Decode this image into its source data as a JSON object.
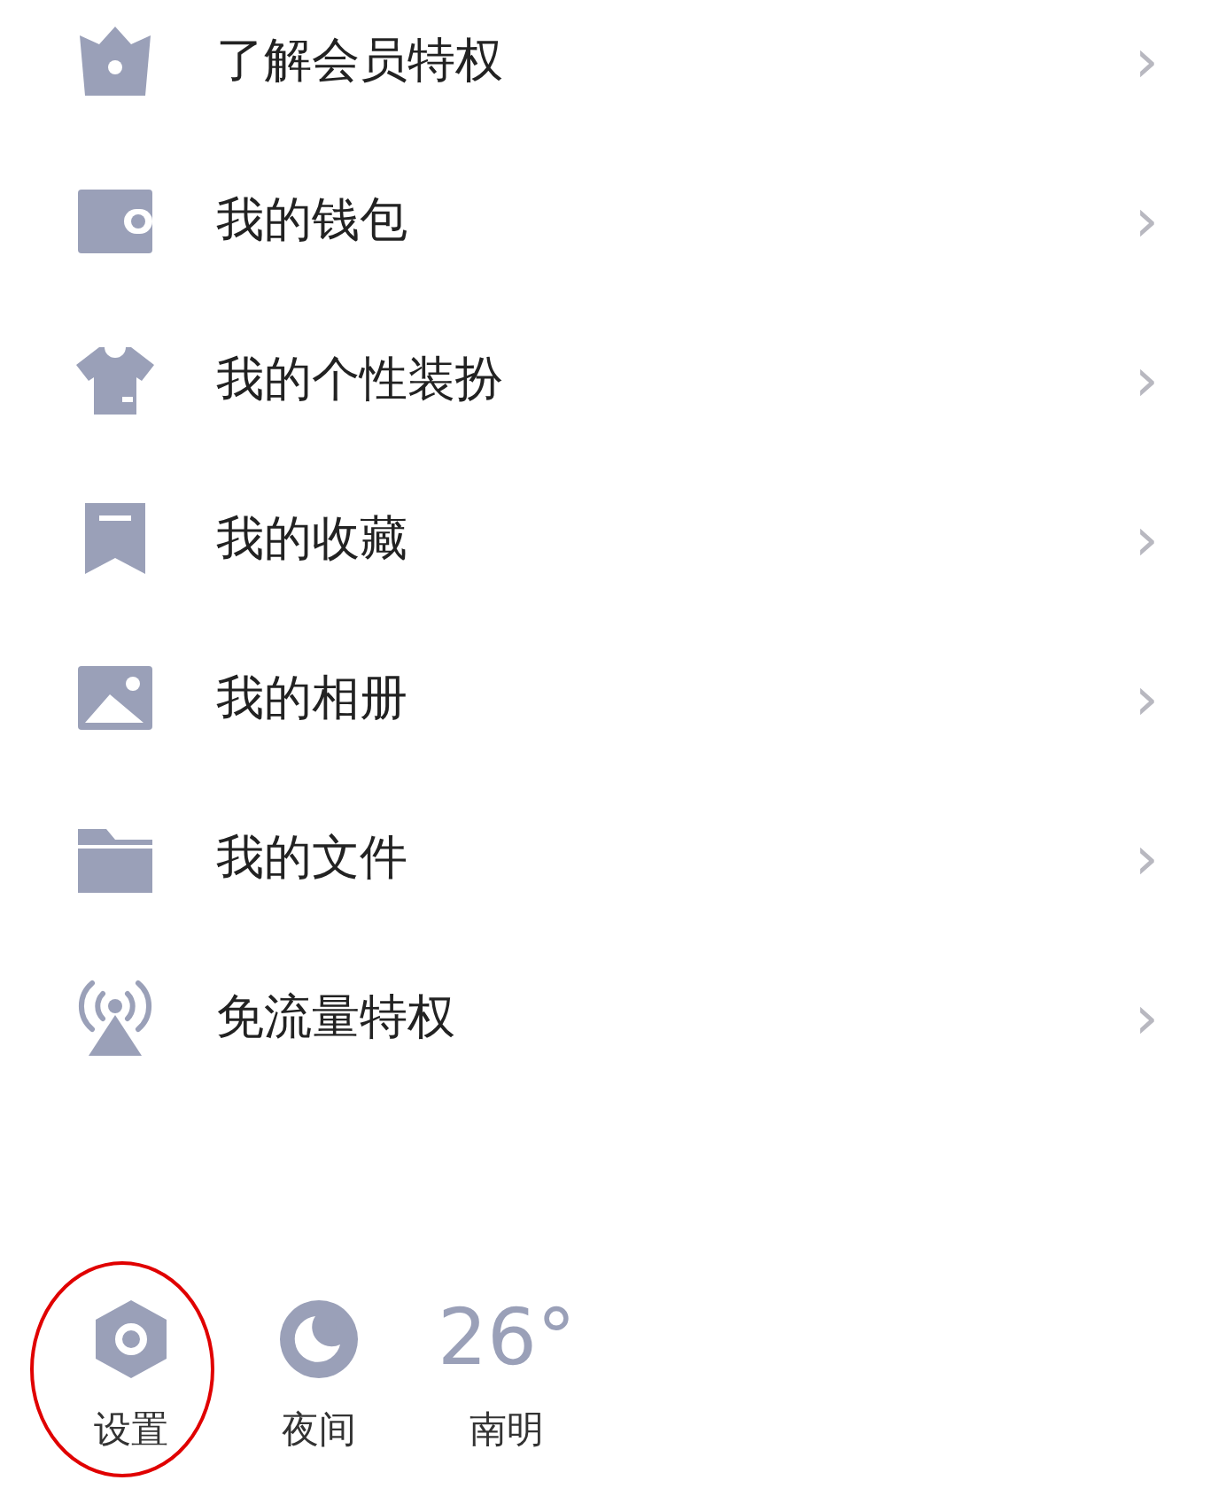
{
  "menu": [
    {
      "kind": "crown",
      "label": "了解会员特权",
      "chevron": "›"
    },
    {
      "kind": "wallet",
      "label": "我的钱包",
      "chevron": "›"
    },
    {
      "kind": "shirt",
      "label": "我的个性装扮",
      "chevron": "›"
    },
    {
      "kind": "bookmark",
      "label": "我的收藏",
      "chevron": "›"
    },
    {
      "kind": "image",
      "label": "我的相册",
      "chevron": "›"
    },
    {
      "kind": "folder",
      "label": "我的文件",
      "chevron": "›"
    },
    {
      "kind": "signal",
      "label": "免流量特权",
      "chevron": "›"
    }
  ],
  "bottom_bar": [
    {
      "kind": "settings",
      "label": "设置",
      "highlighted": true
    },
    {
      "kind": "night",
      "label": "夜间",
      "highlighted": false
    },
    {
      "kind": "weather",
      "temperature": "26°",
      "label": "南明",
      "highlighted": false
    }
  ]
}
